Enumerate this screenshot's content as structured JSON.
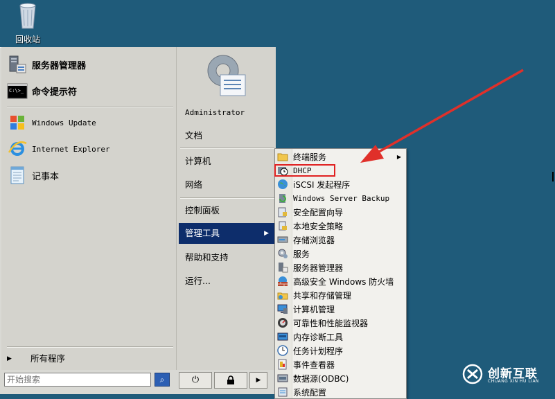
{
  "desktop": {
    "recycle_bin_label": "回收站"
  },
  "start_menu": {
    "pinned": [
      {
        "label": "服务器管理器",
        "icon": "server-manager-icon"
      },
      {
        "label": "命令提示符",
        "icon": "command-prompt-icon"
      }
    ],
    "recent": [
      {
        "label": "Windows Update",
        "icon": "windows-update-icon"
      },
      {
        "label": "Internet Explorer",
        "icon": "internet-explorer-icon"
      },
      {
        "label": "记事本",
        "icon": "notepad-icon"
      }
    ],
    "all_programs": "所有程序",
    "search_placeholder": "开始搜索",
    "right": {
      "user": "Administrator",
      "documents": "文档",
      "computer": "计算机",
      "network": "网络",
      "control_panel": "控制面板",
      "admin_tools": "管理工具",
      "help": "帮助和支持",
      "run": "运行..."
    }
  },
  "submenu": {
    "items": [
      {
        "label": "终端服务",
        "icon": "folder-icon"
      },
      {
        "label": "DHCP",
        "icon": "dhcp-icon"
      },
      {
        "label": "iSCSI 发起程序",
        "icon": "iscsi-globe-icon"
      },
      {
        "label": "Windows Server Backup",
        "icon": "backup-icon"
      },
      {
        "label": "安全配置向导",
        "icon": "security-wizard-icon"
      },
      {
        "label": "本地安全策略",
        "icon": "local-policy-icon"
      },
      {
        "label": "存储浏览器",
        "icon": "storage-explorer-icon"
      },
      {
        "label": "服务",
        "icon": "services-icon"
      },
      {
        "label": "服务器管理器",
        "icon": "server-manager-icon"
      },
      {
        "label": "高级安全 Windows 防火墙",
        "icon": "firewall-icon"
      },
      {
        "label": "共享和存储管理",
        "icon": "share-storage-icon"
      },
      {
        "label": "计算机管理",
        "icon": "computer-management-icon"
      },
      {
        "label": "可靠性和性能监视器",
        "icon": "performance-monitor-icon"
      },
      {
        "label": "内存诊断工具",
        "icon": "memory-diagnostic-icon"
      },
      {
        "label": "任务计划程序",
        "icon": "task-scheduler-icon"
      },
      {
        "label": "事件查看器",
        "icon": "event-viewer-icon"
      },
      {
        "label": "数据源(ODBC)",
        "icon": "odbc-icon"
      },
      {
        "label": "系统配置",
        "icon": "system-config-icon"
      }
    ]
  },
  "watermark": {
    "name": "创新互联",
    "sub": "CHUANG XIN HU LIAN"
  },
  "colors": {
    "desktop": "#1f5b7a",
    "selection": "#0d2d6b",
    "highlight_box": "#e02020",
    "arrow": "#e0302a"
  }
}
